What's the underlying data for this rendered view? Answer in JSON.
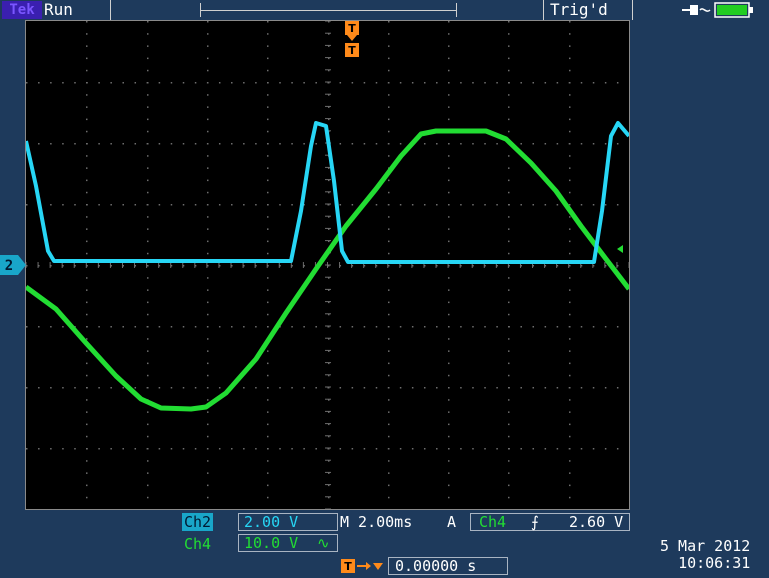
{
  "header": {
    "brand": "Tek",
    "run_state": "Run",
    "trigger_status": "Trig'd"
  },
  "colors": {
    "ch2": "#27d6f5",
    "ch4": "#22dd33",
    "trigger": "#ff8a1a",
    "background": "#1e3a5c"
  },
  "screen": {
    "channel_marker": "2"
  },
  "readouts": {
    "ch2_label": "Ch2",
    "ch2_scale": "2.00 V",
    "ch4_label": "Ch4",
    "ch4_scale": "10.0 V",
    "ch4_coupling_symbol": "∿",
    "timebase": "M 2.00ms",
    "acq_label": "A",
    "trigger_source": "Ch4",
    "trigger_slope_symbol": "⨍",
    "trigger_level": "2.60 V",
    "trigger_position_value": "0.00000 s",
    "date": "5 Mar 2012",
    "time": "10:06:31"
  },
  "icons": [
    "power-plug-icon",
    "battery-icon",
    "trigger-position-icon",
    "trigger-level-icon",
    "channel-2-marker-icon"
  ]
}
